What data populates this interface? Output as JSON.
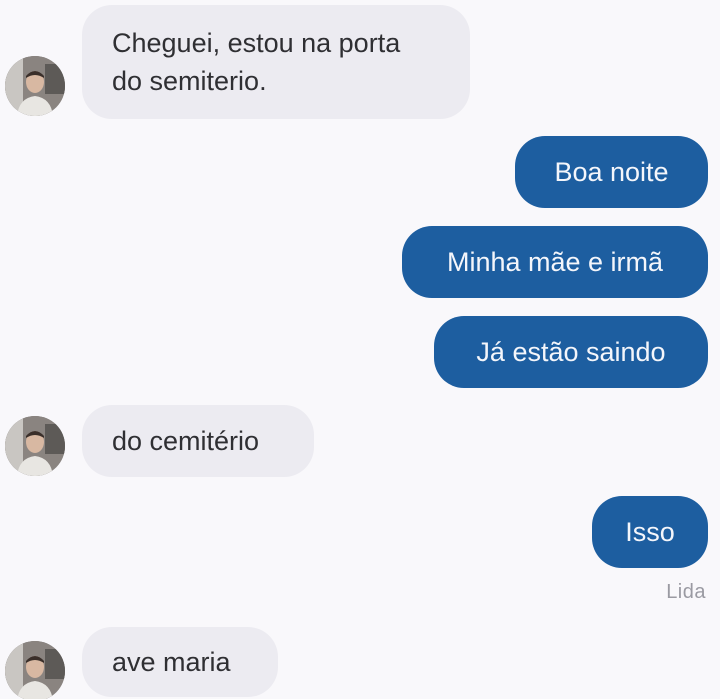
{
  "conversation": {
    "messages": [
      {
        "sender": "contact",
        "text": "Cheguei, estou na porta\ndo semiterio."
      },
      {
        "sender": "me",
        "text": "Boa noite"
      },
      {
        "sender": "me",
        "text": "Minha mãe e irmã"
      },
      {
        "sender": "me",
        "text": "Já estão saindo"
      },
      {
        "sender": "contact",
        "text": "do cemitério"
      },
      {
        "sender": "me",
        "text": "Isso"
      },
      {
        "sender": "contact",
        "text": "ave maria"
      }
    ],
    "read_status": "Lida"
  },
  "icons": {
    "avatar": "contact-avatar"
  },
  "colors": {
    "background": "#f9f8fb",
    "incoming_bubble": "#ecebf1",
    "outgoing_bubble": "#1d5ea0",
    "incoming_text": "#2f2f33",
    "outgoing_text": "#f4f6fb",
    "read_status": "#9a9aa2"
  }
}
